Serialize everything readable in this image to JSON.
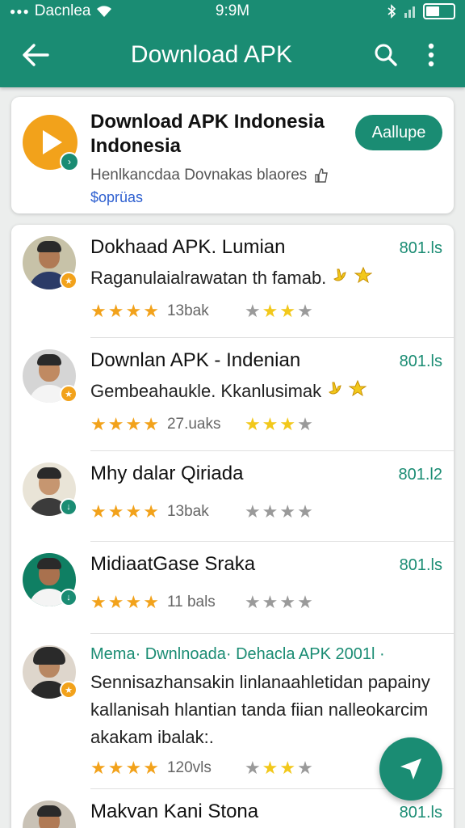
{
  "status_bar": {
    "carrier": "Dacnlea",
    "time": "9:9M"
  },
  "app_bar": {
    "title": "Download APK"
  },
  "header_card": {
    "title": "Download APK Indonesia Indonesia",
    "subtitle": "Henlkancdaa Dovnakas blaores",
    "link": "$oprüas",
    "install_label": "Aallupe"
  },
  "items": [
    {
      "title": "Dokhaad APK. Lumian",
      "size": "801.ls",
      "desc": "Raganulaialrawatan th famab.",
      "rating_count": "13bak",
      "stars_primary": [
        "gold",
        "gold",
        "gold",
        "gold"
      ],
      "stars_secondary": [
        "gray",
        "yellow",
        "yellow",
        "gray"
      ]
    },
    {
      "title": "Downlan APK - Indenian",
      "size": "801.ls",
      "desc": "Gembeahauk​le. Kkanlusimak",
      "rating_count": "27.uaks",
      "stars_primary": [
        "gold",
        "gold",
        "gold",
        "gold"
      ],
      "stars_secondary": [
        "yellow",
        "yellow",
        "yellow",
        "gray"
      ]
    },
    {
      "title": "Mhy dalar Qiriada",
      "size": "801.l2",
      "desc": "",
      "rating_count": "13bak",
      "stars_primary": [
        "gold",
        "gold",
        "gold",
        "gold"
      ],
      "stars_secondary": [
        "gray",
        "gray",
        "gray",
        "gray"
      ]
    },
    {
      "title": "MidiaatGase Sraka",
      "size": "801.ls",
      "desc": "",
      "rating_count": "11 bals",
      "stars_primary": [
        "gold",
        "gold",
        "gold",
        "gold"
      ],
      "stars_secondary": [
        "gray",
        "gray",
        "gray",
        "gray"
      ]
    },
    {
      "title": "Mema· Dwnlnoada· Dehacla APK 2001l ·",
      "size": "",
      "desc": "Sennisazhansakin linlanaahletidan papainy kallanisah hlantian tanda fiian nalleokarcim akakam ibalak:.",
      "rating_count": "120vls",
      "stars_primary": [
        "gold",
        "gold",
        "gold",
        "gold"
      ],
      "stars_secondary": [
        "gray",
        "yellow",
        "yellow",
        "gray"
      ]
    },
    {
      "title": "Makvan Kani Stona",
      "size": "801.ls",
      "desc": "",
      "rating_count": "",
      "stars_primary": [],
      "stars_secondary": []
    }
  ],
  "icons": {
    "back": "arrow-left-icon",
    "search": "search-icon",
    "more": "more-vert-icon",
    "fab": "send-icon"
  },
  "colors": {
    "primary": "#1a8c73",
    "accent": "#f2a21b",
    "link": "#2d5fd0"
  }
}
